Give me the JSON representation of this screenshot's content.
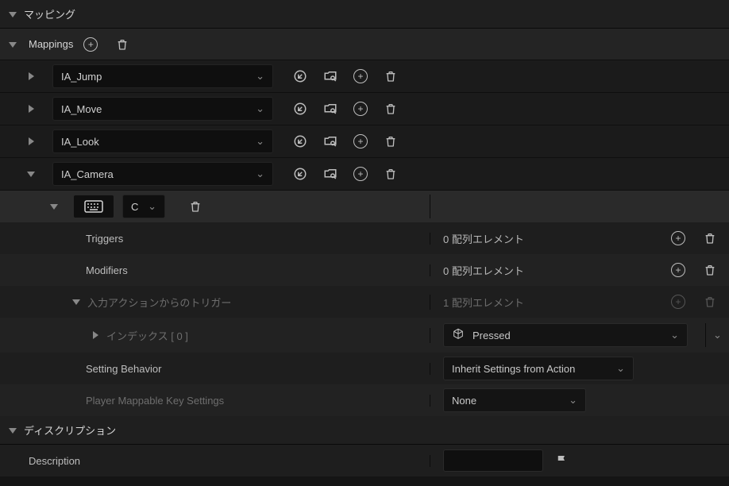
{
  "sections": {
    "mapping_header": "マッピング",
    "mappings_label": "Mappings",
    "description_header": "ディスクリプション",
    "description_label": "Description"
  },
  "mappings": [
    {
      "name": "IA_Jump",
      "expanded": false
    },
    {
      "name": "IA_Move",
      "expanded": false
    },
    {
      "name": "IA_Look",
      "expanded": false
    },
    {
      "name": "IA_Camera",
      "expanded": true
    }
  ],
  "camera": {
    "key": "C",
    "rows": {
      "triggers": {
        "label": "Triggers",
        "value": "0 配列エレメント"
      },
      "modifiers": {
        "label": "Modifiers",
        "value": "0 配列エレメント"
      },
      "input_trigger": {
        "label": "入力アクションからのトリガー",
        "value": "1 配列エレメント"
      },
      "index0": {
        "label": "インデックス [ 0 ]",
        "value": "Pressed"
      },
      "setting_behavior": {
        "label": "Setting Behavior",
        "value": "Inherit Settings from Action"
      },
      "player_mappable": {
        "label": "Player Mappable Key Settings",
        "value": "None"
      }
    }
  },
  "description": {
    "value": ""
  }
}
